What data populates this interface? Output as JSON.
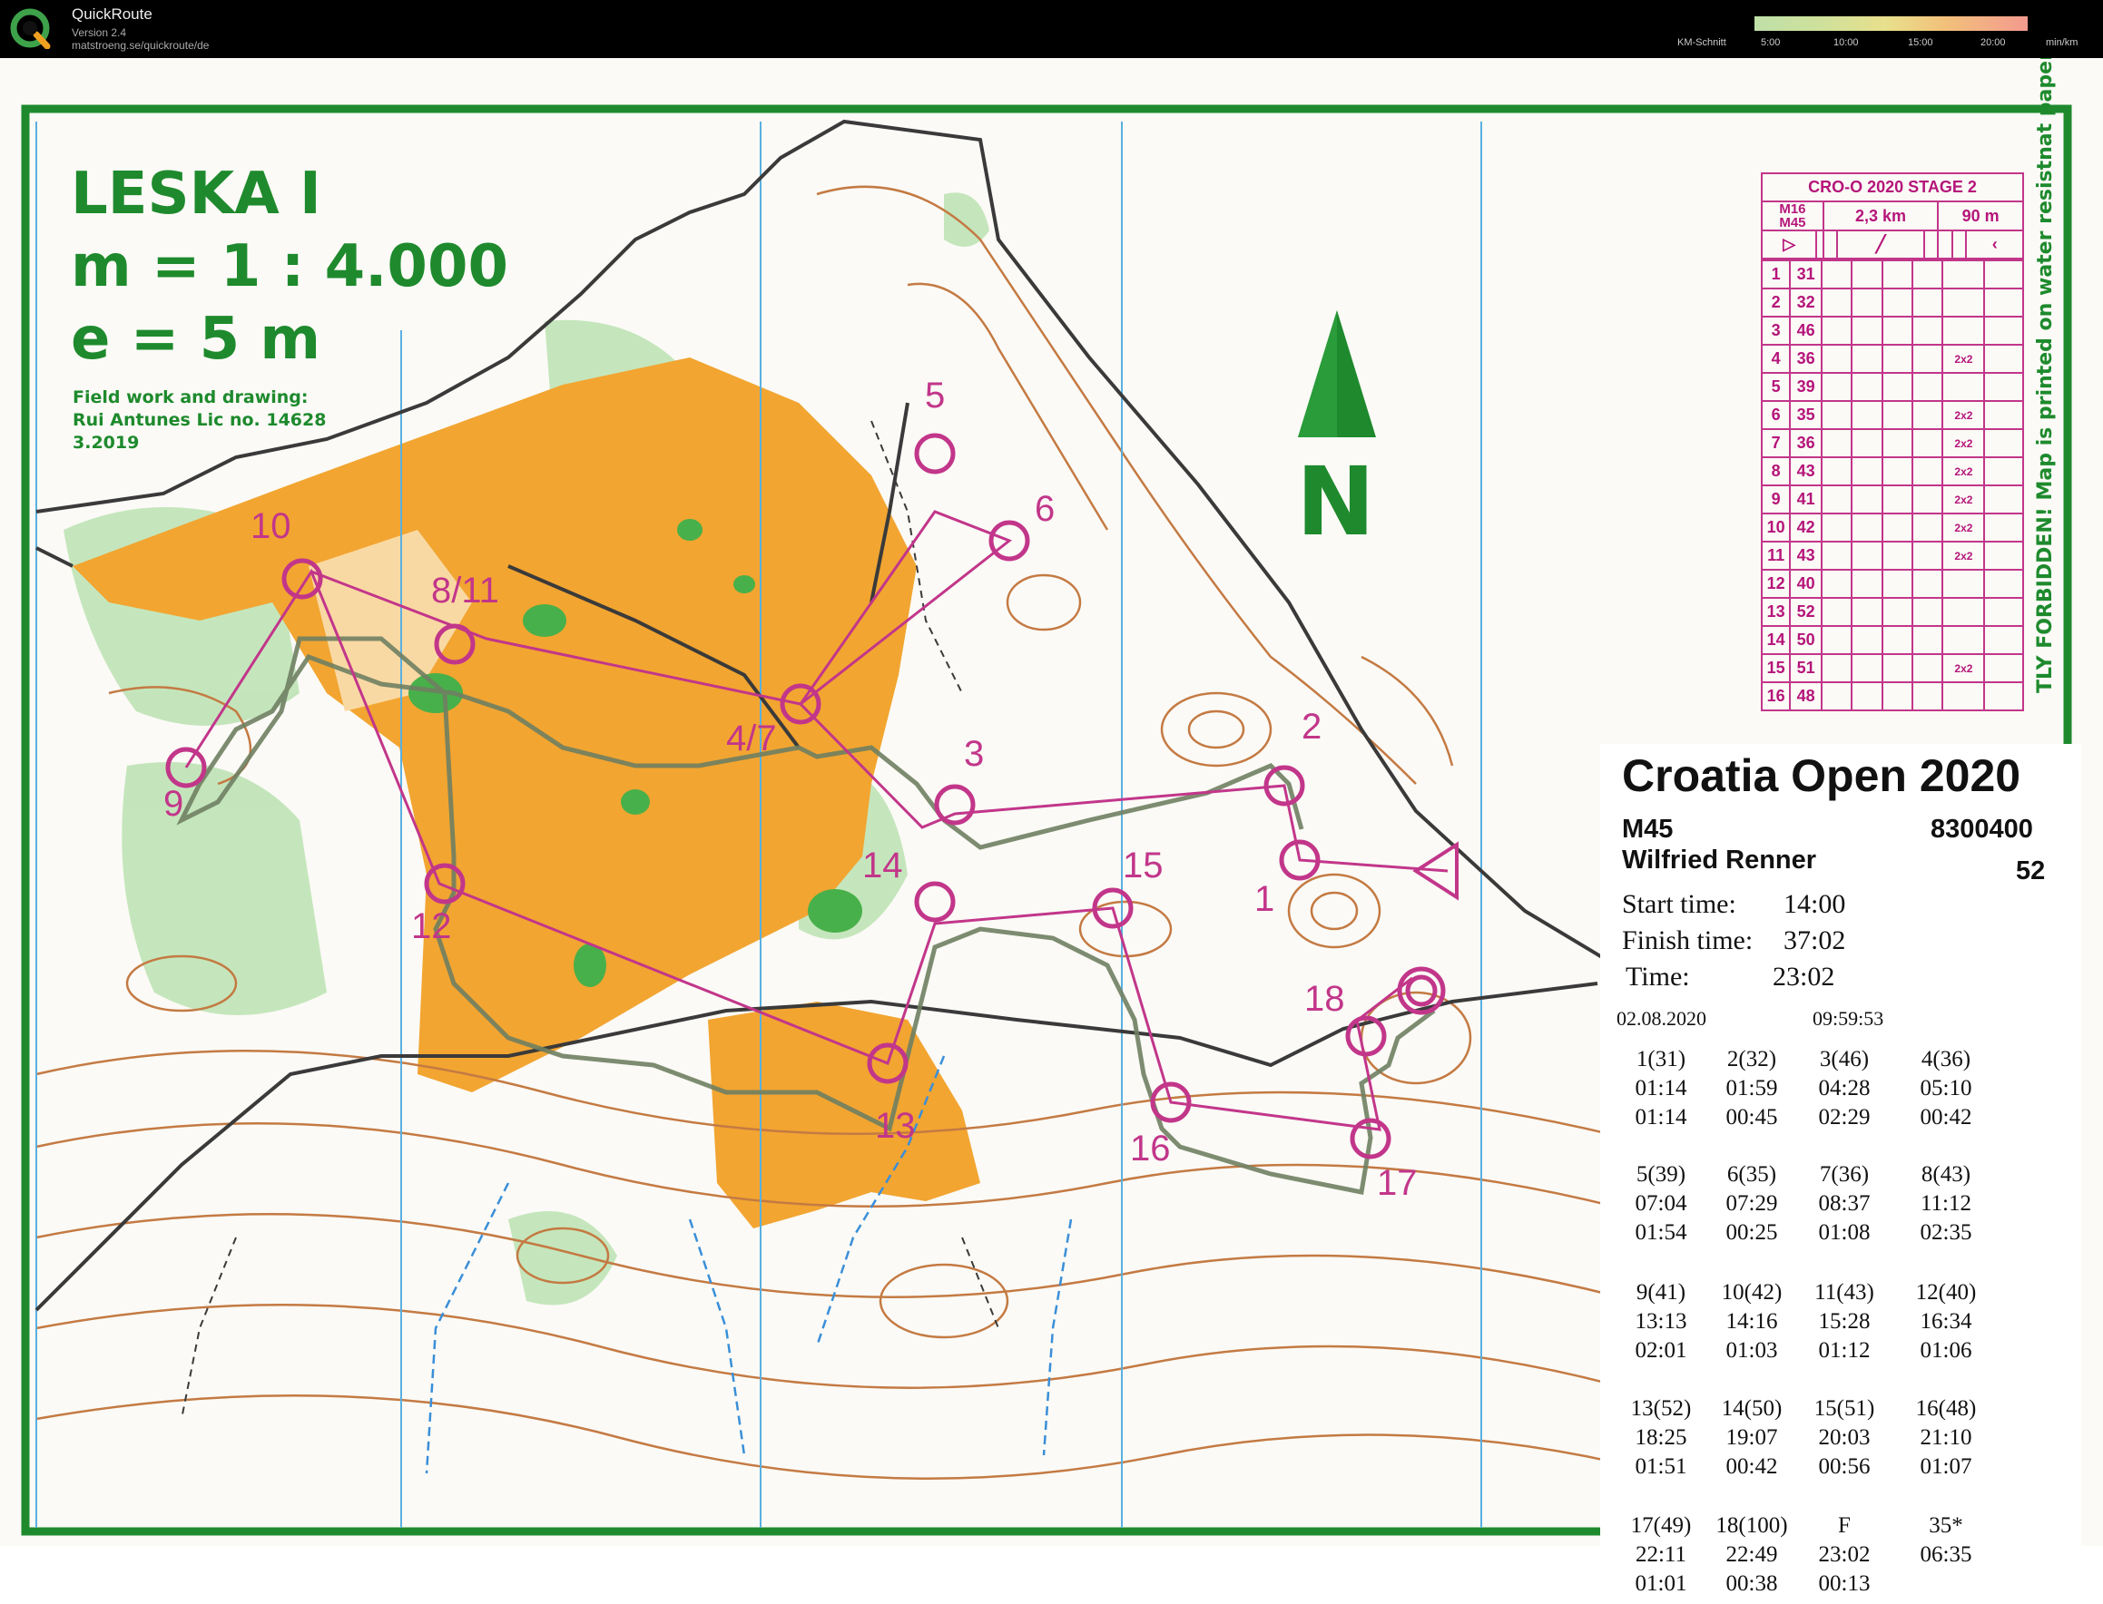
{
  "app": {
    "name": "QuickRoute",
    "version": "Version 2.4",
    "url": "matstroeng.se/quickroute/de",
    "scale_label": "KM-Schnitt",
    "scale_ticks": [
      "5:00",
      "10:00",
      "15:00",
      "20:00"
    ],
    "scale_unit": "min/km"
  },
  "map": {
    "title_lines": [
      "LESKA I",
      "m = 1 : 4.000",
      "e = 5 m"
    ],
    "credit_lines": [
      "Field work and drawing:",
      "Rui Antunes Lic no. 14628",
      "3.2019"
    ],
    "north_letter": "N",
    "colors": {
      "course": "#c2368a",
      "route": "#6f7f62",
      "forest_open": "#f2a531",
      "green": "#48b04a",
      "contour": "#c47a43",
      "frame": "#1e8a2d"
    },
    "control_labels": [
      "10",
      "8/11",
      "9",
      "12",
      "5",
      "6",
      "4/7",
      "3",
      "2",
      "1",
      "14",
      "15",
      "13",
      "16",
      "17",
      "18"
    ],
    "side_text": "TLY FORBIDDEN! Map is printed on water resistnat paper"
  },
  "description": {
    "event": "CRO-O 2020 STAGE 2",
    "classes": [
      "M16",
      "M45"
    ],
    "length": "2,3 km",
    "climb": "90 m",
    "rows": [
      {
        "n": "1",
        "code": "31",
        "extra": ""
      },
      {
        "n": "2",
        "code": "32",
        "extra": ""
      },
      {
        "n": "3",
        "code": "46",
        "extra": ""
      },
      {
        "n": "4",
        "code": "36",
        "extra": "2x2"
      },
      {
        "n": "5",
        "code": "39",
        "extra": ""
      },
      {
        "n": "6",
        "code": "35",
        "extra": "2x2"
      },
      {
        "n": "7",
        "code": "36",
        "extra": "2x2"
      },
      {
        "n": "8",
        "code": "43",
        "extra": "2x2"
      },
      {
        "n": "9",
        "code": "41",
        "extra": "2x2"
      },
      {
        "n": "10",
        "code": "42",
        "extra": "2x2"
      },
      {
        "n": "11",
        "code": "43",
        "extra": "2x2"
      },
      {
        "n": "12",
        "code": "40",
        "extra": ""
      },
      {
        "n": "13",
        "code": "52",
        "extra": ""
      },
      {
        "n": "14",
        "code": "50",
        "extra": ""
      },
      {
        "n": "15",
        "code": "51",
        "extra": "2x2"
      },
      {
        "n": "16",
        "code": "48",
        "extra": ""
      }
    ]
  },
  "result": {
    "title": "Croatia Open 2020",
    "class": "M45",
    "si": "8300400",
    "name": "Wilfried Renner",
    "place": "52",
    "start_label": "Start time:",
    "start": "14:00",
    "finish_label": "Finish time:",
    "finish": "37:02",
    "time_label": "Time:",
    "time": "23:02",
    "date": "02.08.2020",
    "clock": "09:59:53",
    "splits": [
      [
        "1(31)",
        "01:14",
        "01:14"
      ],
      [
        "2(32)",
        "01:59",
        "00:45"
      ],
      [
        "3(46)",
        "04:28",
        "02:29"
      ],
      [
        "4(36)",
        "05:10",
        "00:42"
      ],
      [
        "5(39)",
        "07:04",
        "01:54"
      ],
      [
        "6(35)",
        "07:29",
        "00:25"
      ],
      [
        "7(36)",
        "08:37",
        "01:08"
      ],
      [
        "8(43)",
        "11:12",
        "02:35"
      ],
      [
        "9(41)",
        "13:13",
        "02:01"
      ],
      [
        "10(42)",
        "14:16",
        "01:03"
      ],
      [
        "11(43)",
        "15:28",
        "01:12"
      ],
      [
        "12(40)",
        "16:34",
        "01:06"
      ],
      [
        "13(52)",
        "18:25",
        "01:51"
      ],
      [
        "14(50)",
        "19:07",
        "00:42"
      ],
      [
        "15(51)",
        "20:03",
        "00:56"
      ],
      [
        "16(48)",
        "21:10",
        "01:07"
      ],
      [
        "17(49)",
        "22:11",
        "01:01"
      ],
      [
        "18(100)",
        "22:49",
        "00:38"
      ],
      [
        "F",
        "23:02",
        "00:13"
      ],
      [
        "35*",
        "06:35",
        ""
      ]
    ]
  }
}
